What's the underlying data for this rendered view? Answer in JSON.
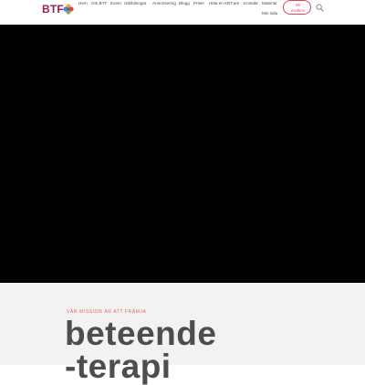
{
  "brand": {
    "logo_text": "BTF"
  },
  "nav": {
    "items": [
      "Hem",
      "Om BTF",
      "Event",
      "Utbildningar",
      "Annonsering",
      "Blogg",
      "Priser",
      "Hitta en KBT:are",
      "Kontakt",
      "Material",
      "Min sida"
    ]
  },
  "cta": {
    "line1": "Bli",
    "line2": "medlem"
  },
  "hero": {
    "mission": "VÅR MISSION ÄR ATT FRÄMJA",
    "headline_line1": "beteende",
    "headline_line2": "-terapi"
  },
  "colors": {
    "accent": "#e0445a",
    "logo": "#a3195b",
    "video_bg": "#000000",
    "hero_bg": "#f2f2f2"
  },
  "icons": {
    "search": "search-icon",
    "logo_mark": "flower-icon"
  }
}
